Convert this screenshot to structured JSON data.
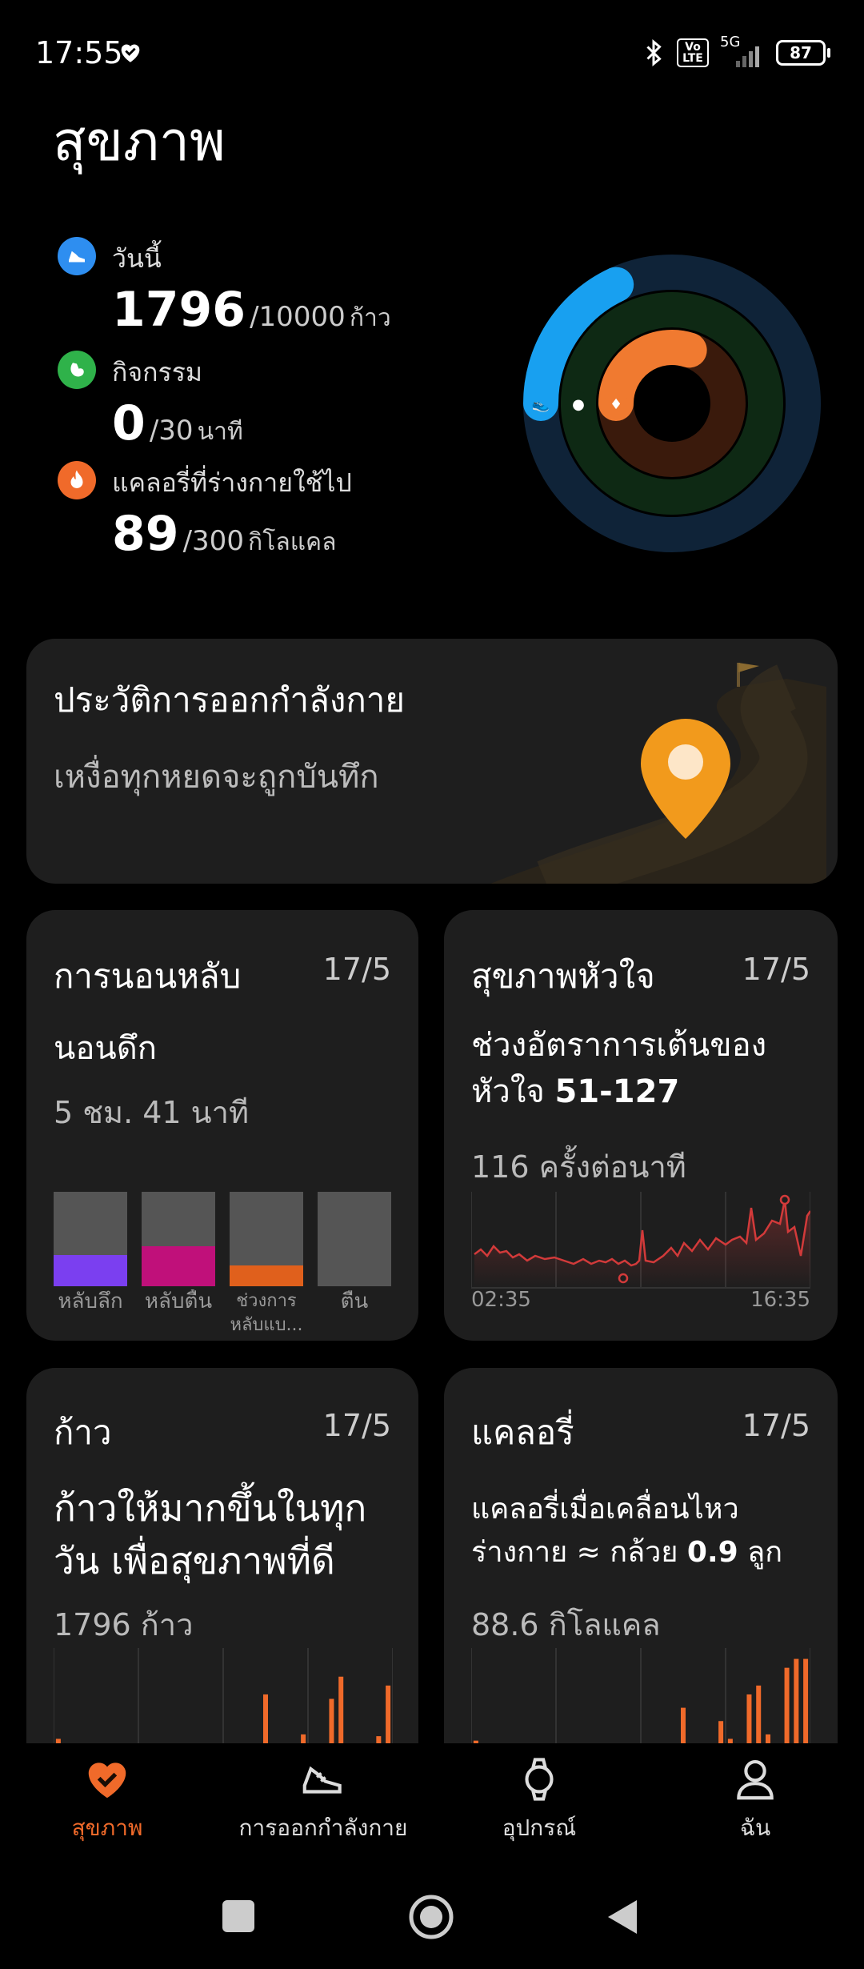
{
  "status": {
    "time": "17:55",
    "network": "5G",
    "volte": "Vo LTE",
    "battery": "87"
  },
  "title": "สุขภาพ",
  "metrics": {
    "steps": {
      "label": "วันนี้",
      "value": "1796",
      "goal": "/10000",
      "unit": "ก้าว",
      "color": "#2e8ef0"
    },
    "activity": {
      "label": "กิจกรรม",
      "value": "0",
      "goal": "/30",
      "unit": "นาที",
      "color": "#2fb24a"
    },
    "calories": {
      "label": "แคลอรี่ที่ร่างกายใช้ไป",
      "value": "89",
      "goal": "/300",
      "unit": "กิโลแคล",
      "color": "#f06a2a"
    }
  },
  "rings": {
    "steps_fraction": 0.18,
    "activity_fraction": 0.0,
    "calories_fraction": 0.3
  },
  "exercise_card": {
    "title": "ประวัติการออกกำลังกาย",
    "subtitle": "เหงื่อทุกหยดจะถูกบันทึก"
  },
  "sleep_card": {
    "title": "การนอนหลับ",
    "date": "17/5",
    "headline": "นอนดึก",
    "duration": "5 ชม. 41 นาที",
    "bars": [
      {
        "label": "หลับลึก",
        "fraction": 0.33,
        "color": "#7b3ff0"
      },
      {
        "label": "หลับตื้น",
        "fraction": 0.42,
        "color": "#c0107a"
      },
      {
        "label": "ช่วงการหลับแบ...",
        "fraction": 0.22,
        "color": "#e0601c"
      },
      {
        "label": "ตื่น",
        "fraction": 0.0,
        "color": "#e0601c"
      }
    ]
  },
  "heart_card": {
    "title": "สุขภาพหัวใจ",
    "date": "17/5",
    "headline_line1": "ช่วงอัตราการเต้นของ",
    "headline_line2_prefix": "หัวใจ ",
    "headline_line2_value": "51-127",
    "bpm": "116 ครั้งต่อนาที",
    "start_time": "02:35",
    "end_time": "16:35"
  },
  "steps_card": {
    "title": "ก้าว",
    "date": "17/5",
    "headline_line1": "ก้าวให้มากขึ้นในทุก",
    "headline_line2": "วัน เพื่อสุขภาพที่ดี",
    "total": "1796 ก้าว",
    "bars": [
      0.05,
      0,
      0,
      0,
      0,
      0,
      0,
      0,
      0,
      0,
      0,
      0,
      0,
      0,
      0,
      0,
      0,
      0,
      0,
      0,
      0,
      0,
      0.55,
      0,
      0,
      0,
      0.1,
      0,
      0,
      0.5,
      0.75,
      0,
      0,
      0,
      0.08,
      0.65
    ]
  },
  "calories_card": {
    "title": "แคลอรี่",
    "date": "17/5",
    "headline_line1": "แคลอรี่เมื่อเคลื่อนไหว",
    "headline_line2_prefix": "ร่างกาย ≈ กล้วย ",
    "headline_line2_value": "0.9",
    "headline_line2_suffix": " ลูก",
    "total": "88.6 กิโลแคล",
    "bars": [
      0.03,
      0,
      0,
      0,
      0,
      0,
      0,
      0,
      0,
      0,
      0,
      0,
      0,
      0,
      0,
      0,
      0,
      0,
      0,
      0,
      0,
      0,
      0.4,
      0,
      0,
      0,
      0.25,
      0.05,
      0,
      0.55,
      0.65,
      0.1,
      0,
      0.85,
      0.95,
      0.95
    ]
  },
  "nav": [
    {
      "label": "สุขภาพ",
      "icon": "heart-check-icon",
      "active": true
    },
    {
      "label": "การออกกำลังกาย",
      "icon": "shoe-icon",
      "active": false
    },
    {
      "label": "อุปกรณ์",
      "icon": "watch-icon",
      "active": false
    },
    {
      "label": "ฉัน",
      "icon": "person-icon",
      "active": false
    }
  ],
  "colors": {
    "accent": "#f06a2a",
    "card_bg": "#1e1e1e",
    "heart_line": "#d23a3a"
  }
}
